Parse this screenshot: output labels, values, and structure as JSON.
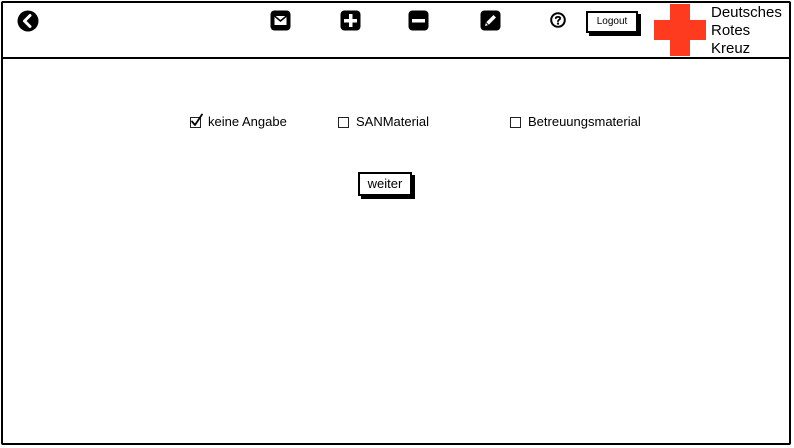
{
  "toolbar": {
    "back_icon": "back-circle-icon",
    "mail_icon": "mail-icon",
    "add_icon": "plus-icon",
    "remove_icon": "minus-icon",
    "edit_icon": "pencil-icon",
    "help_icon": "help-icon",
    "logout_label": "Logout"
  },
  "logo": {
    "line1": "Deutsches",
    "line2": "Rotes",
    "line3": "Kreuz",
    "color": "#ff3b1f"
  },
  "options": [
    {
      "label": "keine Angabe",
      "checked": true
    },
    {
      "label": "SANMaterial",
      "checked": false
    },
    {
      "label": "Betreuungsmaterial",
      "checked": false
    }
  ],
  "continue_label": "weiter"
}
